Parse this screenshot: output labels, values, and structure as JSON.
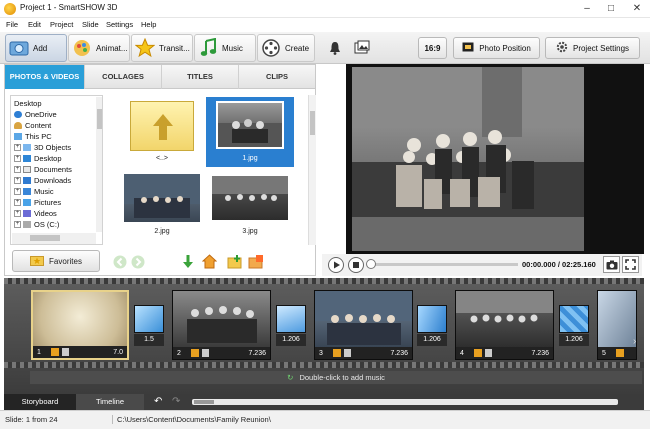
{
  "window": {
    "title": "Project 1 - SmartSHOW 3D",
    "minimize": "–",
    "maximize": "□",
    "close": "✕"
  },
  "menu": [
    "File",
    "Edit",
    "Project",
    "Slide",
    "Settings",
    "Help"
  ],
  "toolbar": {
    "tools": [
      {
        "label": "Add",
        "icon": "add-photo-icon"
      },
      {
        "label": "Animat...",
        "icon": "animation-icon"
      },
      {
        "label": "Transit...",
        "icon": "transition-star-icon"
      },
      {
        "label": "Music",
        "icon": "music-note-icon"
      },
      {
        "label": "Create",
        "icon": "film-reel-icon"
      }
    ],
    "aspect": "16:9",
    "photo_position": "Photo Position",
    "project_settings": "Project Settings"
  },
  "left": {
    "tabs": [
      "PHOTOS & VIDEOS",
      "COLLAGES",
      "TITLES",
      "CLIPS"
    ],
    "tree": [
      "Desktop",
      "OneDrive",
      "Content",
      "This PC",
      "3D Objects",
      "Desktop",
      "Documents",
      "Downloads",
      "Music",
      "Pictures",
      "Videos",
      "OS (C:)"
    ],
    "files": [
      {
        "name": "<..>"
      },
      {
        "name": "1.jpg"
      },
      {
        "name": "2.jpg"
      },
      {
        "name": "3.jpg"
      }
    ],
    "favorites": "Favorites"
  },
  "player": {
    "time": "00:00.000 / 02:25.160"
  },
  "slides": [
    {
      "num": "1",
      "dur": "7.0"
    },
    {
      "num": "2",
      "dur": "7.236"
    },
    {
      "num": "3",
      "dur": "7.236"
    },
    {
      "num": "4",
      "dur": "7.236"
    },
    {
      "num": "5",
      "dur": ""
    }
  ],
  "transitions": [
    "1.5",
    "1.206",
    "1.206",
    "1.206"
  ],
  "music_hint": "Double-click to add music",
  "bottom_tabs": [
    "Storyboard",
    "Timeline"
  ],
  "status": {
    "slide": "Slide: 1 from 24",
    "path": "C:\\Users\\Content\\Documents\\Family Reunion\\"
  },
  "colors": {
    "accent": "#2a9fd8",
    "selection": "#2a7fd0",
    "slide_border": "#e8d28a"
  }
}
